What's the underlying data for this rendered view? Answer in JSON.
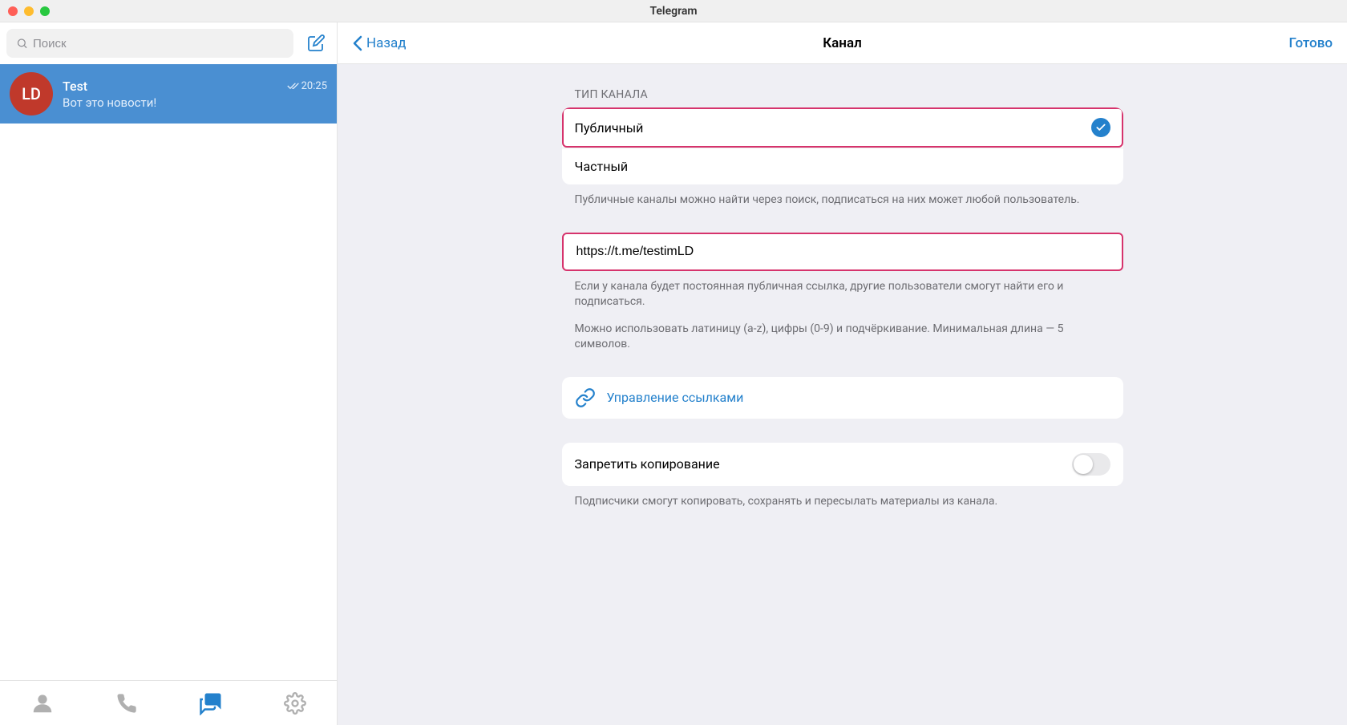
{
  "window": {
    "title": "Telegram"
  },
  "sidebar": {
    "search_placeholder": "Поиск",
    "chat": {
      "avatar_initials": "LD",
      "title": "Test",
      "preview": "Вот это новости!",
      "time": "20:25"
    }
  },
  "header": {
    "back": "Назад",
    "title": "Канал",
    "done": "Готово"
  },
  "channel_type": {
    "section_label": "ТИП КАНАЛА",
    "public": "Публичный",
    "private": "Частный",
    "helper": "Публичные каналы можно найти через поиск, подписаться на них может любой пользователь."
  },
  "link": {
    "value": "https://t.me/testimLD",
    "helper1": "Если у канала будет постоянная публичная ссылка, другие пользователи смогут найти его и подписаться.",
    "helper2": "Можно использовать латиницу (a-z), цифры (0-9) и подчёркивание. Минимальная длина — 5 символов."
  },
  "manage_links": {
    "label": "Управление ссылками"
  },
  "restrict": {
    "label": "Запретить копирование",
    "helper": "Подписчики смогут копировать, сохранять и пересылать материалы из канала."
  }
}
